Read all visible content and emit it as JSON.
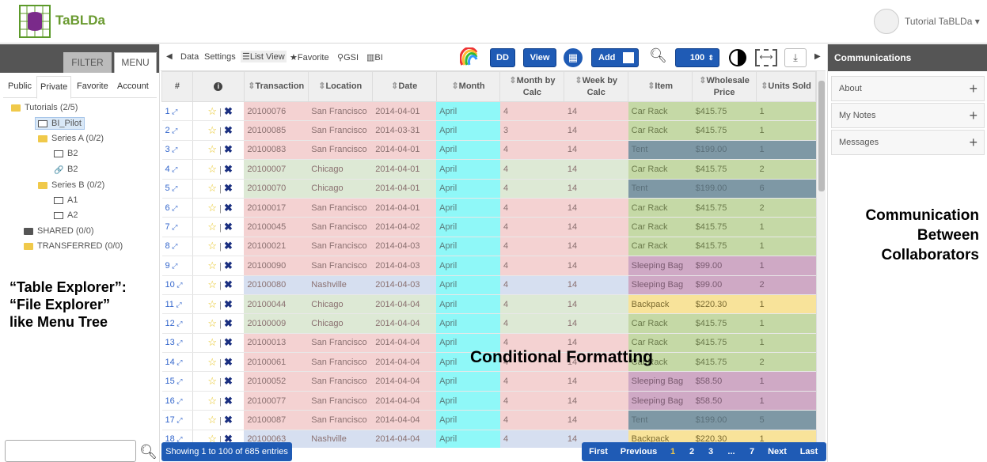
{
  "app": {
    "brand": "TaBLDa",
    "user": "Tutorial TaBLDa ▾"
  },
  "left": {
    "filter_label": "FILTER",
    "menu_label": "MENU",
    "tabs": [
      "Public",
      "Private",
      "Favorite",
      "Account"
    ],
    "tree": [
      {
        "label": "Tutorials (2/5)",
        "icon": "folder-icon"
      },
      {
        "label": "BI_Pilot",
        "icon": "table-icon"
      },
      {
        "label": "Series A (0/2)",
        "icon": "folder-icon"
      },
      {
        "label": "B2",
        "icon": "table-icon"
      },
      {
        "label": "B2",
        "icon": "link-icon"
      },
      {
        "label": "Series B (0/2)",
        "icon": "folder-icon"
      },
      {
        "label": "A1",
        "icon": "table-icon"
      },
      {
        "label": "A2",
        "icon": "table-icon"
      },
      {
        "label": "SHARED (0/0)",
        "icon": "folder-dark-icon"
      },
      {
        "label": "TRANSFERRED (0/0)",
        "icon": "folder-icon"
      }
    ],
    "annotation": [
      "“Table Explorer”:",
      "“File Explorer”",
      "like Menu Tree"
    ]
  },
  "toolbar": {
    "data": "Data",
    "settings": "Settings",
    "list_view": "List View",
    "favorite": "Favorite",
    "gsi": "GSI",
    "bi": "BI",
    "dd": "DD",
    "view": "View",
    "add": "Add",
    "page_size": "100"
  },
  "table": {
    "headers": [
      "#",
      "",
      "Transaction",
      "Location",
      "Date",
      "Month",
      "Month by Calc",
      "Week by Calc",
      "Item",
      "Wholesale Price",
      "Units Sold"
    ],
    "rows": [
      {
        "n": "1",
        "tx": "20100076",
        "loc": "San Francisco",
        "date": "2014-04-01",
        "month": "April",
        "mbc": "4",
        "wbc": "14",
        "item": "Car Rack",
        "price": "$415.75",
        "units": "1",
        "tone": "pink",
        "it": "car"
      },
      {
        "n": "2",
        "tx": "20100085",
        "loc": "San Francisco",
        "date": "2014-03-31",
        "month": "April",
        "mbc": "3",
        "wbc": "14",
        "item": "Car Rack",
        "price": "$415.75",
        "units": "1",
        "tone": "pink",
        "it": "car"
      },
      {
        "n": "3",
        "tx": "20100083",
        "loc": "San Francisco",
        "date": "2014-04-01",
        "month": "April",
        "mbc": "4",
        "wbc": "14",
        "item": "Tent",
        "price": "$199.00",
        "units": "1",
        "tone": "pink",
        "it": "tent"
      },
      {
        "n": "4",
        "tx": "20100007",
        "loc": "Chicago",
        "date": "2014-04-01",
        "month": "April",
        "mbc": "4",
        "wbc": "14",
        "item": "Car Rack",
        "price": "$415.75",
        "units": "2",
        "tone": "green",
        "it": "car"
      },
      {
        "n": "5",
        "tx": "20100070",
        "loc": "Chicago",
        "date": "2014-04-01",
        "month": "April",
        "mbc": "4",
        "wbc": "14",
        "item": "Tent",
        "price": "$199.00",
        "units": "6",
        "tone": "green",
        "it": "tent"
      },
      {
        "n": "6",
        "tx": "20100017",
        "loc": "San Francisco",
        "date": "2014-04-01",
        "month": "April",
        "mbc": "4",
        "wbc": "14",
        "item": "Car Rack",
        "price": "$415.75",
        "units": "2",
        "tone": "pink",
        "it": "car"
      },
      {
        "n": "7",
        "tx": "20100045",
        "loc": "San Francisco",
        "date": "2014-04-02",
        "month": "April",
        "mbc": "4",
        "wbc": "14",
        "item": "Car Rack",
        "price": "$415.75",
        "units": "1",
        "tone": "pink",
        "it": "car"
      },
      {
        "n": "8",
        "tx": "20100021",
        "loc": "San Francisco",
        "date": "2014-04-03",
        "month": "April",
        "mbc": "4",
        "wbc": "14",
        "item": "Car Rack",
        "price": "$415.75",
        "units": "1",
        "tone": "pink",
        "it": "car"
      },
      {
        "n": "9",
        "tx": "20100090",
        "loc": "San Francisco",
        "date": "2014-04-03",
        "month": "April",
        "mbc": "4",
        "wbc": "14",
        "item": "Sleeping Bag",
        "price": "$99.00",
        "units": "1",
        "tone": "pink",
        "it": "sleep"
      },
      {
        "n": "10",
        "tx": "20100080",
        "loc": "Nashville",
        "date": "2014-04-03",
        "month": "April",
        "mbc": "4",
        "wbc": "14",
        "item": "Sleeping Bag",
        "price": "$99.00",
        "units": "2",
        "tone": "blue",
        "it": "sleep"
      },
      {
        "n": "11",
        "tx": "20100044",
        "loc": "Chicago",
        "date": "2014-04-04",
        "month": "April",
        "mbc": "4",
        "wbc": "14",
        "item": "Backpack",
        "price": "$220.30",
        "units": "1",
        "tone": "green",
        "it": "back"
      },
      {
        "n": "12",
        "tx": "20100009",
        "loc": "Chicago",
        "date": "2014-04-04",
        "month": "April",
        "mbc": "4",
        "wbc": "14",
        "item": "Car Rack",
        "price": "$415.75",
        "units": "1",
        "tone": "green",
        "it": "car"
      },
      {
        "n": "13",
        "tx": "20100013",
        "loc": "San Francisco",
        "date": "2014-04-04",
        "month": "April",
        "mbc": "4",
        "wbc": "14",
        "item": "Car Rack",
        "price": "$415.75",
        "units": "1",
        "tone": "pink",
        "it": "car"
      },
      {
        "n": "14",
        "tx": "20100061",
        "loc": "San Francisco",
        "date": "2014-04-04",
        "month": "April",
        "mbc": "4",
        "wbc": "14",
        "item": "Car Rack",
        "price": "$415.75",
        "units": "2",
        "tone": "pink",
        "it": "car"
      },
      {
        "n": "15",
        "tx": "20100052",
        "loc": "San Francisco",
        "date": "2014-04-04",
        "month": "April",
        "mbc": "4",
        "wbc": "14",
        "item": "Sleeping Bag",
        "price": "$58.50",
        "units": "1",
        "tone": "pink",
        "it": "sleep"
      },
      {
        "n": "16",
        "tx": "20100077",
        "loc": "San Francisco",
        "date": "2014-04-04",
        "month": "April",
        "mbc": "4",
        "wbc": "14",
        "item": "Sleeping Bag",
        "price": "$58.50",
        "units": "1",
        "tone": "pink",
        "it": "sleep"
      },
      {
        "n": "17",
        "tx": "20100087",
        "loc": "San Francisco",
        "date": "2014-04-04",
        "month": "April",
        "mbc": "4",
        "wbc": "14",
        "item": "Tent",
        "price": "$199.00",
        "units": "5",
        "tone": "pink",
        "it": "tent"
      },
      {
        "n": "18",
        "tx": "20100063",
        "loc": "Nashville",
        "date": "2014-04-04",
        "month": "April",
        "mbc": "4",
        "wbc": "14",
        "item": "Backpack",
        "price": "$220.30",
        "units": "1",
        "tone": "blue",
        "it": "back"
      }
    ],
    "info": "Showing 1 to 100 of 685 entries",
    "annotation": "Conditional Formatting"
  },
  "pager": {
    "first": "First",
    "previous": "Previous",
    "pages": [
      "1",
      "2",
      "3",
      "...",
      "7"
    ],
    "next": "Next",
    "last": "Last"
  },
  "right": {
    "title": "Communications",
    "sections": [
      "About",
      "My Notes",
      "Messages"
    ],
    "annotation": [
      "Communication",
      "Between",
      "Collaborators"
    ]
  }
}
